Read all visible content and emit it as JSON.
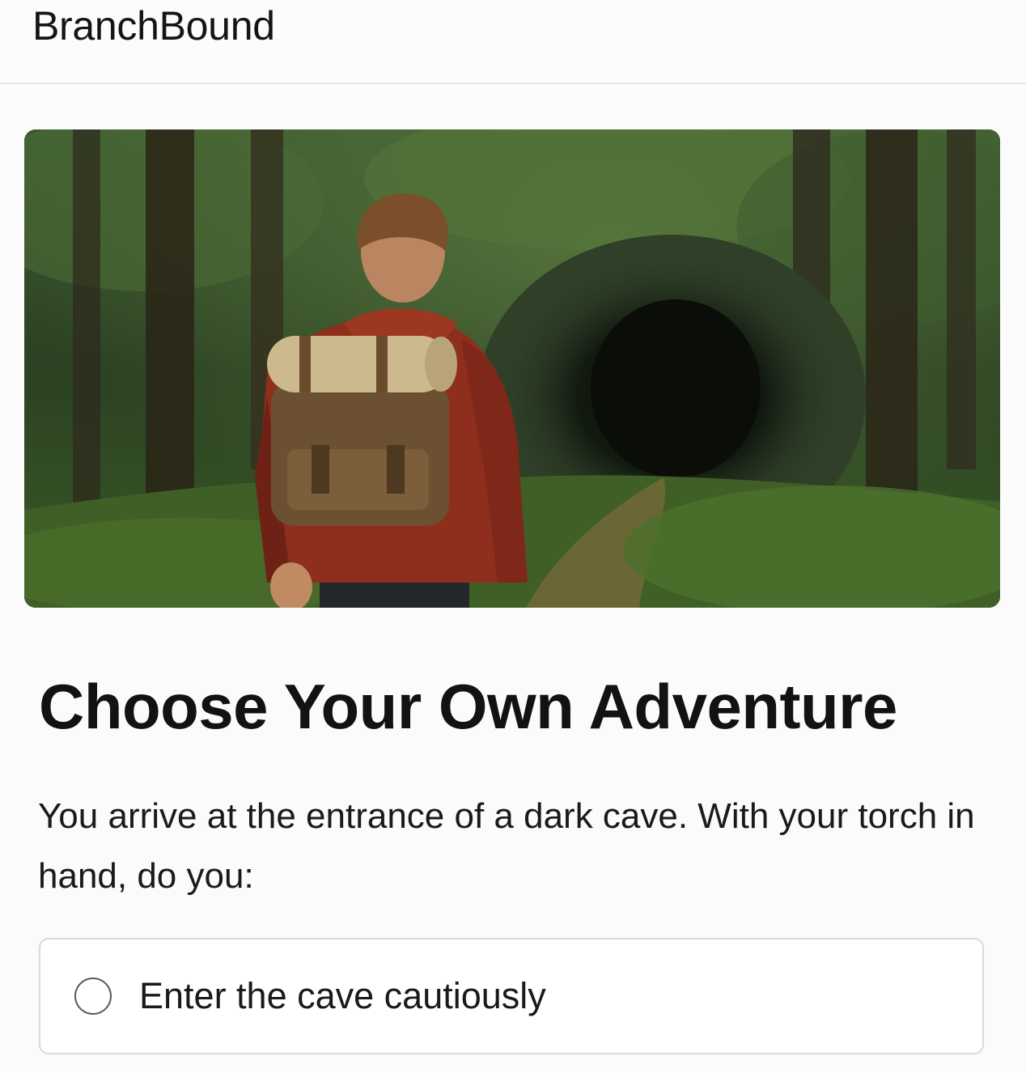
{
  "header": {
    "brand": "BranchBound"
  },
  "hero": {
    "image": "forest-cave-illustration",
    "alt_subject": "boy with backpack facing a dark cave in a forest"
  },
  "main": {
    "title": "Choose Your Own Adventure",
    "story_text": "You arrive at the entrance of a dark cave. With your torch in hand, do you:",
    "choices": [
      {
        "label": "Enter the cave cautiously",
        "selected": false
      }
    ]
  },
  "colors": {
    "background": "#fbfbfb",
    "text": "#141414",
    "border": "#d9d9d9",
    "forest_dark": "#1d2a17",
    "jacket_red": "#8e2e1c"
  },
  "icons": {
    "choice_radio": "radio-unselected-icon"
  }
}
